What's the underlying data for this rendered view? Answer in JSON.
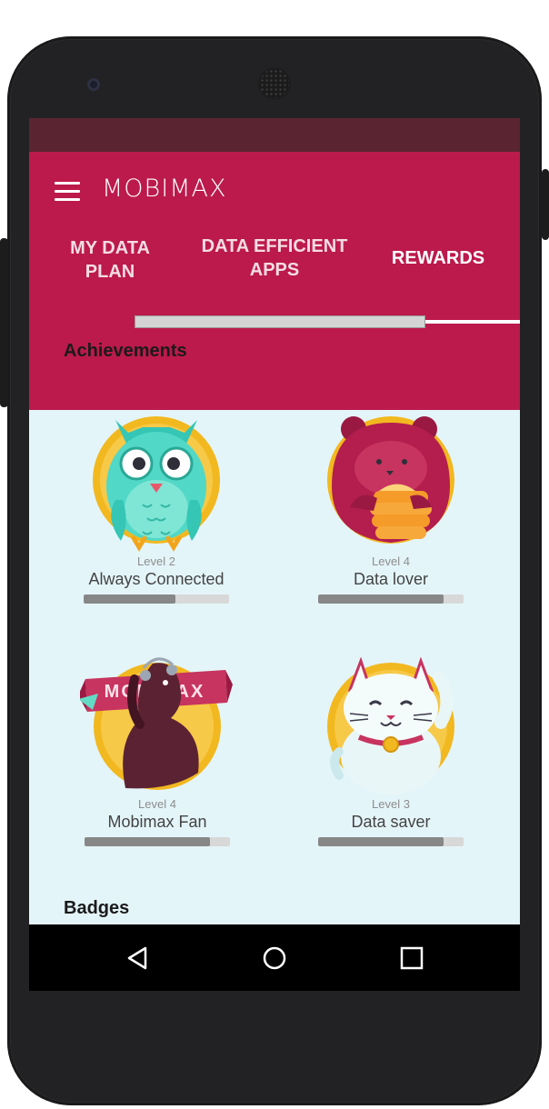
{
  "app": {
    "title": "MOBIMAX"
  },
  "tabs": [
    {
      "label_line1": "MY DATA",
      "label_line2": "PLAN",
      "active": false
    },
    {
      "label_line1": "DATA EFFICIENT",
      "label_line2": "APPS",
      "active": false
    },
    {
      "label_line1": "REWARDS",
      "label_line2": "",
      "active": true
    }
  ],
  "sections": {
    "achievements_title": "Achievements",
    "badges_title": "Badges"
  },
  "achievements": [
    {
      "level": "Level 2",
      "name": "Always Connected",
      "progress": 0.63,
      "icon": "owl-icon"
    },
    {
      "level": "Level 4",
      "name": "Data lover",
      "progress": 0.86,
      "icon": "bear-icon"
    },
    {
      "level": "Level 4",
      "name": "Mobimax Fan",
      "progress": 0.86,
      "icon": "dog-icon",
      "ribbon_text": "MOBIMAX"
    },
    {
      "level": "Level 3",
      "name": "Data saver",
      "progress": 0.86,
      "icon": "lucky-cat-icon"
    }
  ],
  "nav": [
    "back-icon",
    "home-icon",
    "recents-icon"
  ],
  "colors": {
    "appbar": "#bc1a4c",
    "statusbar": "#5a2430",
    "content_bg": "#e4f5f9",
    "progress_fill": "#878787"
  }
}
